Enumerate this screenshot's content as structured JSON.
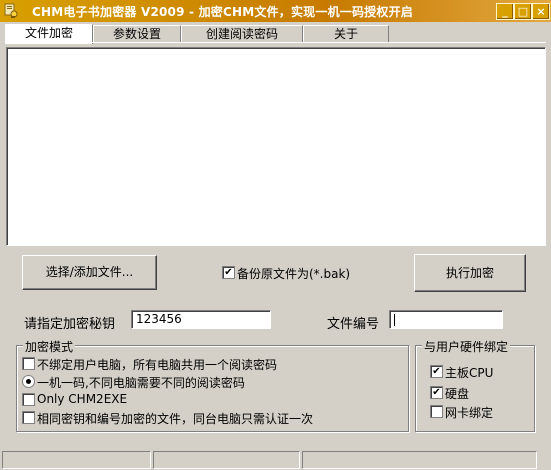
{
  "window": {
    "title": "CHM电子书加密器 V2009 - 加密CHM文件，实现一机一码授权开启"
  },
  "titlebar": {
    "minimize": "_",
    "maximize": "□",
    "close": "×"
  },
  "tabs": [
    {
      "label": "文件加密",
      "active": true
    },
    {
      "label": "参数设置",
      "active": false
    },
    {
      "label": "创建阅读密码",
      "active": false
    },
    {
      "label": "关于",
      "active": false
    }
  ],
  "actions": {
    "select_files": "选择/添加文件...",
    "backup_label": "备份原文件为(*.bak)",
    "backup_checked": true,
    "encrypt": "执行加密"
  },
  "fields": {
    "key_label": "请指定加密秘钥",
    "key_value": "123456",
    "file_no_label": "文件编号",
    "file_no_value": ""
  },
  "encrypt_mode": {
    "title": "加密模式",
    "opt_unbound": "不绑定用户电脑，所有电脑共用一个阅读密码",
    "opt_one_machine": "一机一码,不同电脑需要不同的阅读密码",
    "opt_only_exe": "Only CHM2EXE",
    "opt_same_key": "相同密钥和编号加密的文件，同台电脑只需认证一次",
    "selected": "opt_one_machine"
  },
  "hardware": {
    "title": "与用户硬件绑定",
    "cpu": "主板CPU",
    "cpu_checked": true,
    "disk": "硬盘",
    "disk_checked": true,
    "nic": "网卡绑定",
    "nic_checked": false
  },
  "colors": {
    "titlebar": "#c77a00",
    "face": "#d4d0c8"
  }
}
